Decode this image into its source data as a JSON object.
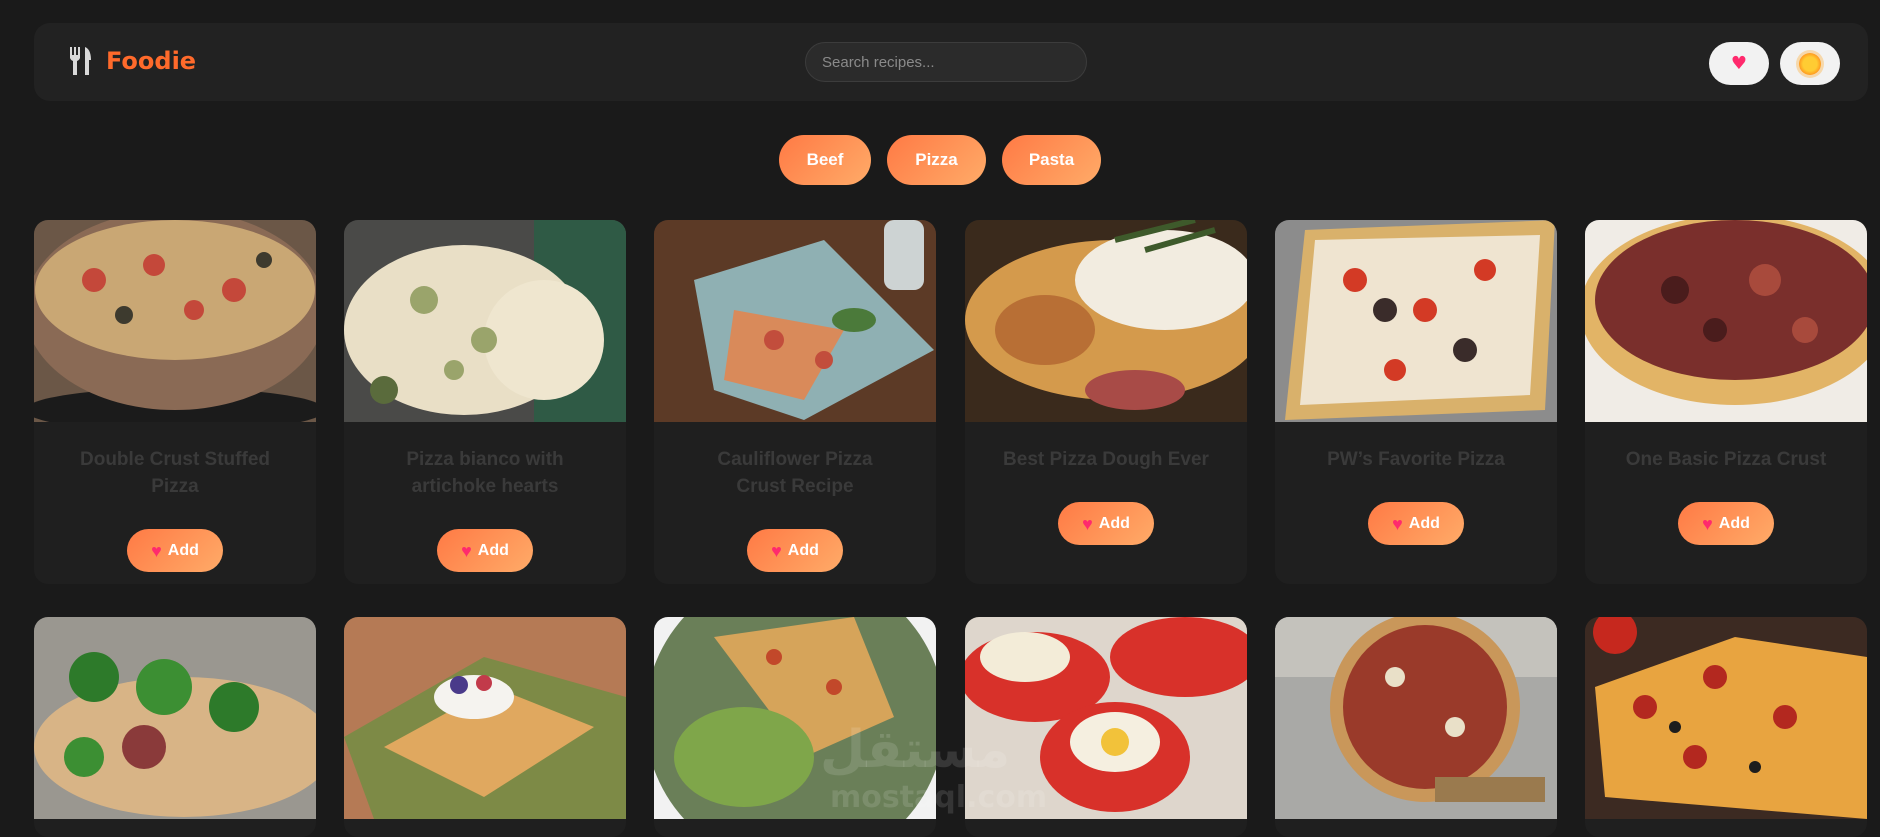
{
  "brand": {
    "name": "Foodie",
    "icon": "fork-knife-icon"
  },
  "search": {
    "placeholder": "Search recipes..."
  },
  "header_buttons": {
    "favorites_icon": "heart-icon",
    "theme_icon": "sun-icon"
  },
  "categories": [
    "Beef",
    "Pizza",
    "Pasta"
  ],
  "add_label": "Add",
  "recipes_row1": [
    {
      "title": "Double Crust Stuffed Pizza"
    },
    {
      "title": "Pizza bianco with artichoke hearts"
    },
    {
      "title": "Cauliflower Pizza Crust Recipe"
    },
    {
      "title": "Best Pizza Dough Ever"
    },
    {
      "title": "PW’s Favorite Pizza"
    },
    {
      "title": "One Basic Pizza Crust"
    }
  ],
  "watermark": {
    "arabic": "مستقل",
    "latin": "mostaql.com"
  },
  "colors": {
    "accent": "#ff6a2b",
    "button_gradient_start": "#ff7a45",
    "button_gradient_end": "#ffab68",
    "heart": "#ff2a6d"
  }
}
